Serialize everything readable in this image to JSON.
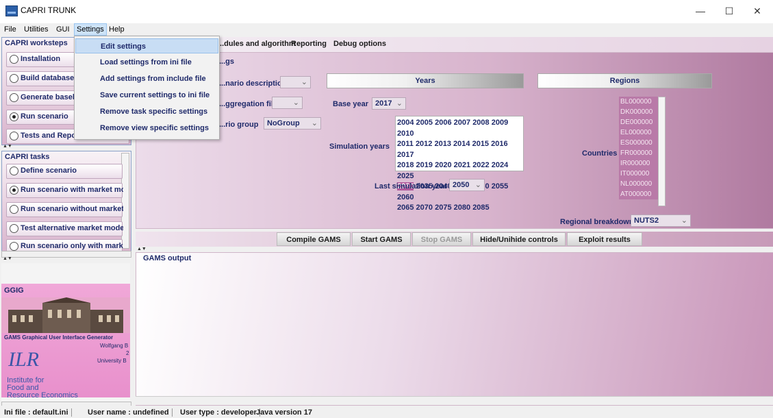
{
  "window": {
    "title": "CAPRI TRUNK",
    "minimize": "—",
    "maximize": "☐",
    "close": "✕"
  },
  "menubar": {
    "items": [
      "File",
      "Utilities",
      "GUI",
      "Settings",
      "Help"
    ]
  },
  "dropdown": {
    "items": [
      "Edit settings",
      "Load settings from ini file",
      "Add settings from include file",
      "Save current settings to ini file",
      "Remove task specific settings",
      "Remove view specific settings"
    ]
  },
  "worksteps": {
    "title": "CAPRI worksteps",
    "items": [
      {
        "label": "Installation",
        "selected": false
      },
      {
        "label": "Build database",
        "selected": false
      },
      {
        "label": "Generate baseline",
        "selected": false
      },
      {
        "label": "Run scenario",
        "selected": true
      },
      {
        "label": "Tests and Reports",
        "selected": false
      }
    ]
  },
  "tasks": {
    "title": "CAPRI tasks",
    "items": [
      {
        "label": "Define scenario",
        "selected": false
      },
      {
        "label": "Run scenario with market model",
        "selected": true
      },
      {
        "label": "Run scenario without market model",
        "selected": false
      },
      {
        "label": "Test alternative market model",
        "selected": false
      },
      {
        "label": "Run scenario only with market",
        "selected": false
      }
    ]
  },
  "logo": {
    "title": "GGIG",
    "caption": "GAMS Graphical User Interface Generator",
    "author": "Wolfgang B",
    "year": "2",
    "univ": "University B",
    "ilr": "ILR",
    "institute": [
      "Institute for",
      "Food and",
      "Resource Economics"
    ]
  },
  "tabs": [
    "...dules and algorithm",
    "Reporting",
    "Debug options"
  ],
  "settings": {
    "group_title": "...gs",
    "scenario_description_label": "...nario description",
    "aggregation_file_label": "...ggregation file",
    "scenario_group_label": "...rio group",
    "scenario_group_value": "NoGroup",
    "years_header": "Years",
    "regions_header": "Regions",
    "base_year_label": "Base year",
    "base_year_value": "2017",
    "simulation_years_label": "Simulation years",
    "years": [
      [
        "2004",
        "2005",
        "2006",
        "2007",
        "2008",
        "2009",
        "2010"
      ],
      [
        "2011",
        "2012",
        "2013",
        "2014",
        "2015",
        "2016",
        "2017"
      ],
      [
        "2018",
        "2019",
        "2020",
        "2021",
        "2022",
        "2024",
        "2025"
      ],
      [
        "2030",
        "2035",
        "2040",
        "2045",
        "2050",
        "2055",
        "2060"
      ],
      [
        "2065",
        "2070",
        "2075",
        "2080",
        "2085"
      ]
    ],
    "selected_year": "2030",
    "last_simulation_year_label": "Last simulation year",
    "last_simulation_year_value": "2050",
    "countries_label": "Countries",
    "countries": [
      "BL000000",
      "DK000000",
      "DE000000",
      "EL000000",
      "ES000000",
      "FR000000",
      "IR000000",
      "IT000000",
      "NL000000",
      "AT000000"
    ],
    "regional_breakdown_label": "Regional breakdown",
    "regional_breakdown_value": "NUTS2"
  },
  "buttons": [
    "Compile GAMS",
    "Start GAMS",
    "Stop GAMS",
    "Hide/Unihide controls",
    "Exploit results"
  ],
  "output": {
    "title": "GAMS output"
  },
  "status": [
    "Ini file : default.ini",
    "User name : undefined",
    "User type : developer",
    "Java version 17"
  ]
}
